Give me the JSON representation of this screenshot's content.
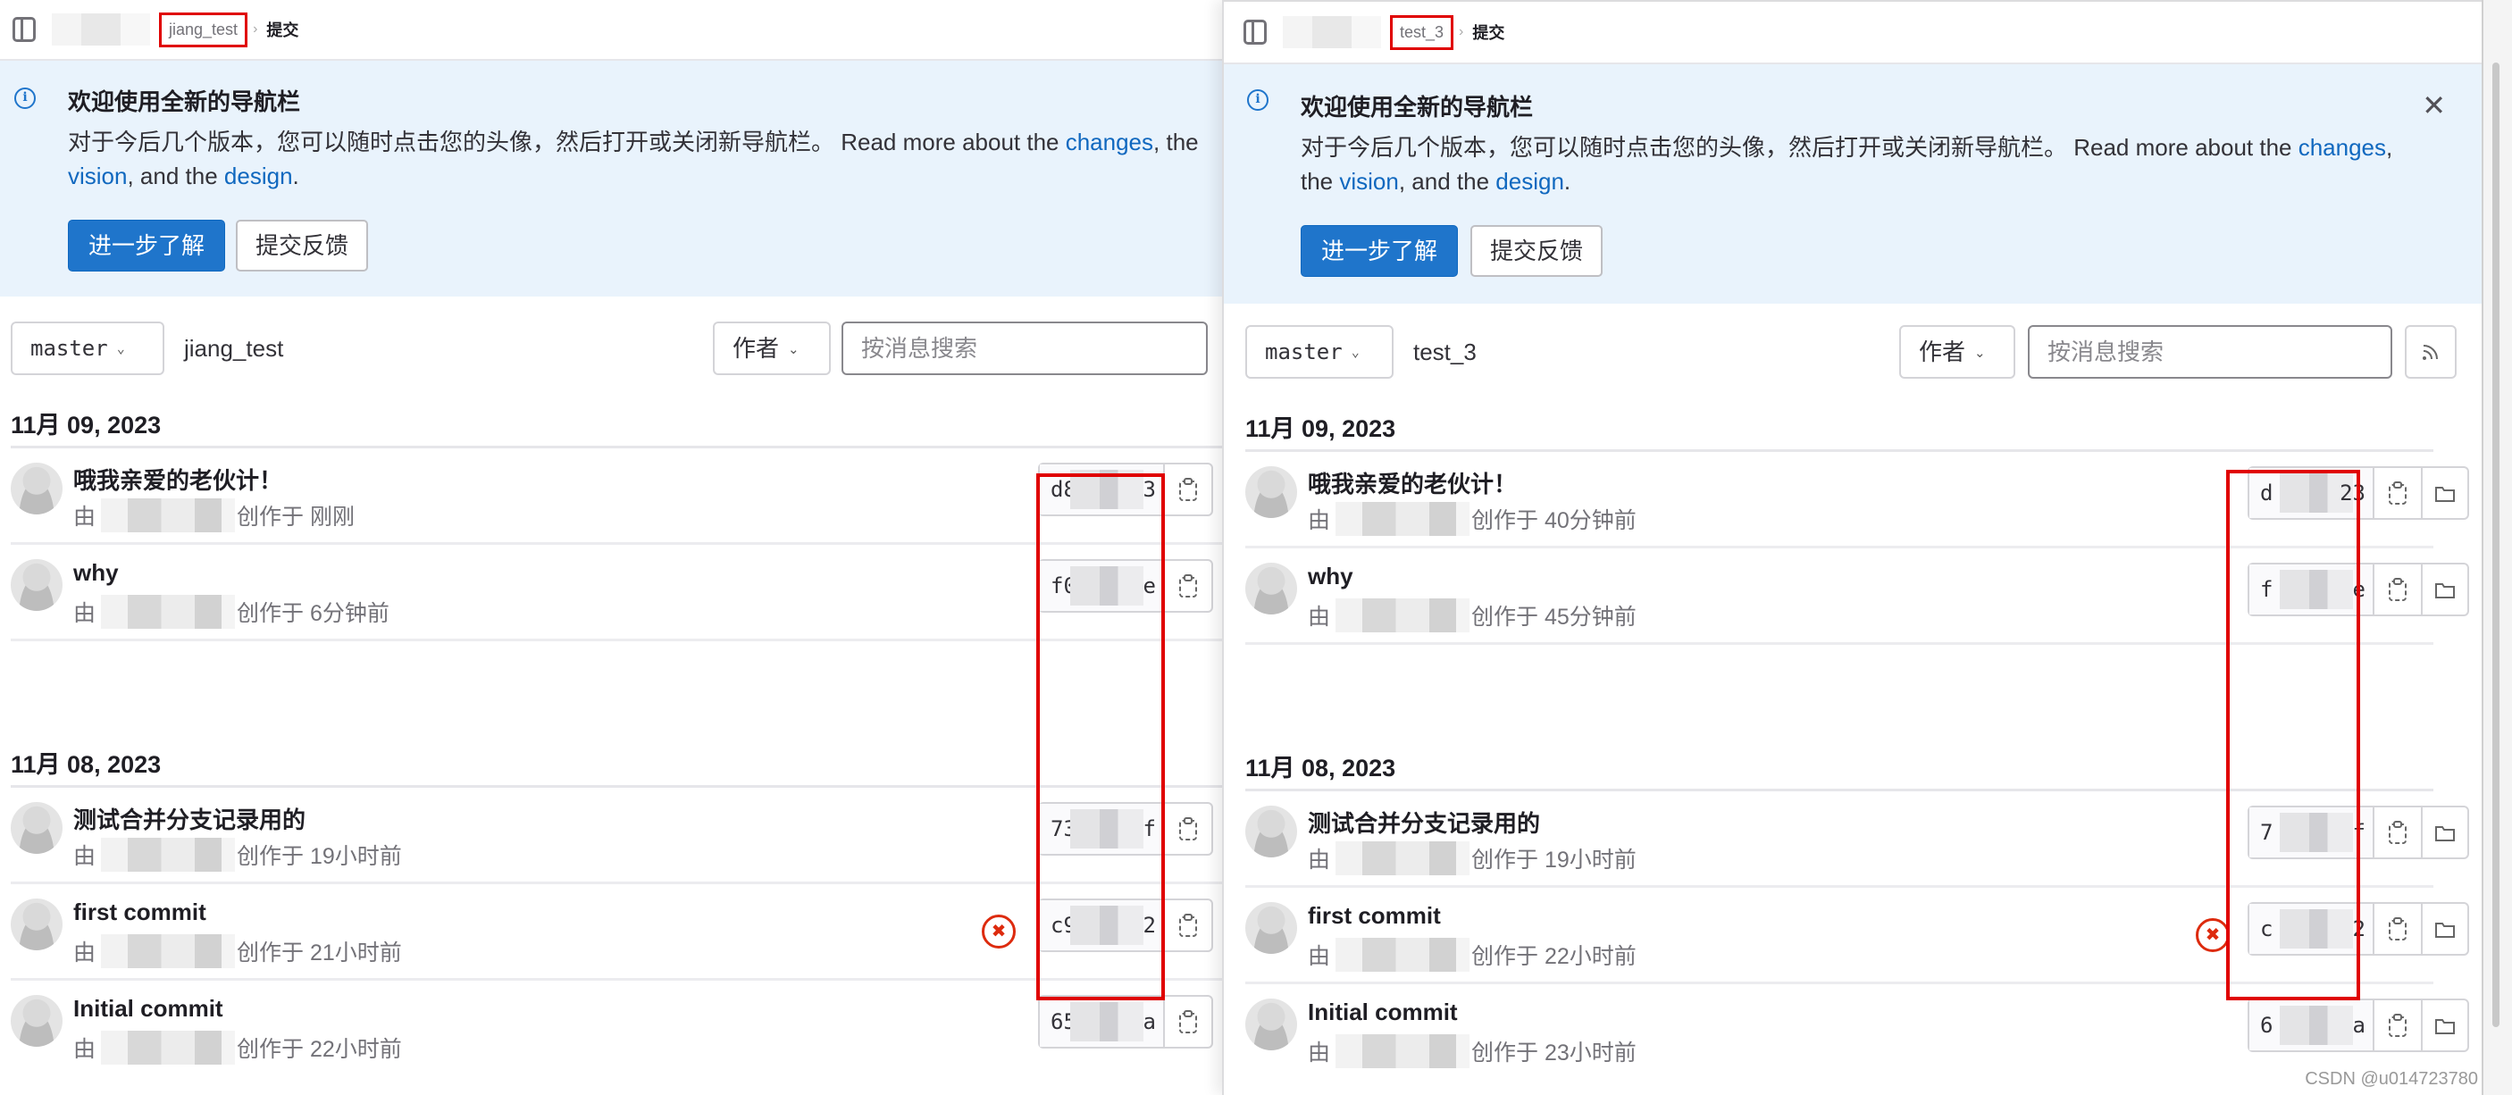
{
  "windows": [
    {
      "id": "left",
      "breadcrumb": {
        "project": "jiang_test",
        "current": "提交"
      },
      "banner": {
        "title": "欢迎使用全新的导航栏",
        "body_prefix": "对于今后几个版本，您可以随时点击您的头像，然后打开或关闭新导航栏。 Read more about the ",
        "link_changes": "changes",
        "sep1": ", the ",
        "link_vision": "vision",
        "sep2": ", and the ",
        "link_design": "design",
        "suffix": ".",
        "primary_button": "进一步了解",
        "secondary_button": "提交反馈",
        "closable": false
      },
      "toolbar": {
        "ref": "master",
        "project": "jiang_test",
        "author_filter": "作者",
        "search_placeholder": "按消息搜索",
        "rss": false
      },
      "groups": [
        {
          "date": "11月 09, 2023",
          "commits": [
            {
              "title": "哦我亲爱的老伙计！",
              "by": "由",
              "created": "创作于 刚刚",
              "sha_start": "d8",
              "sha_end": "3",
              "pipeline_failed": false
            },
            {
              "title": "why",
              "by": "由",
              "created": "创作于 6分钟前",
              "sha_start": "f0",
              "sha_end": "e",
              "pipeline_failed": false
            }
          ]
        },
        {
          "date": "11月 08, 2023",
          "commits": [
            {
              "title": "测试合并分支记录用的",
              "by": "由",
              "created": "创作于 19小时前",
              "sha_start": "73",
              "sha_end": "f",
              "pipeline_failed": false
            },
            {
              "title": "first commit",
              "by": "由",
              "created": "创作于 21小时前",
              "sha_start": "c9",
              "sha_end": "2",
              "pipeline_failed": true
            },
            {
              "title": "Initial commit",
              "by": "由",
              "created": "创作于 22小时前",
              "sha_start": "65",
              "sha_end": "a",
              "pipeline_failed": false
            }
          ]
        }
      ]
    },
    {
      "id": "right",
      "breadcrumb": {
        "project": "test_3",
        "current": "提交"
      },
      "banner": {
        "title": "欢迎使用全新的导航栏",
        "body_prefix": "对于今后几个版本，您可以随时点击您的头像，然后打开或关闭新导航栏。 Read more about the ",
        "link_changes": "changes",
        "sep1": ", the ",
        "link_vision": "vision",
        "sep2": ", and the ",
        "link_design": "design",
        "suffix": ".",
        "primary_button": "进一步了解",
        "secondary_button": "提交反馈",
        "closable": true
      },
      "toolbar": {
        "ref": "master",
        "project": "test_3",
        "author_filter": "作者",
        "search_placeholder": "按消息搜索",
        "rss": true
      },
      "groups": [
        {
          "date": "11月 09, 2023",
          "commits": [
            {
              "title": "哦我亲爱的老伙计！",
              "by": "由",
              "created": "创作于 40分钟前",
              "sha_start": "d",
              "sha_end": "23",
              "pipeline_failed": false
            },
            {
              "title": "why",
              "by": "由",
              "created": "创作于 45分钟前",
              "sha_start": "f",
              "sha_end": "e",
              "pipeline_failed": false
            }
          ]
        },
        {
          "date": "11月 08, 2023",
          "commits": [
            {
              "title": "测试合并分支记录用的",
              "by": "由",
              "created": "创作于 19小时前",
              "sha_start": "7",
              "sha_end": "f",
              "pipeline_failed": false
            },
            {
              "title": "first commit",
              "by": "由",
              "created": "创作于 22小时前",
              "sha_start": "c",
              "sha_end": "2",
              "pipeline_failed": true
            },
            {
              "title": "Initial commit",
              "by": "由",
              "created": "创作于 23小时前",
              "sha_start": "6",
              "sha_end": "a",
              "pipeline_failed": false
            }
          ]
        }
      ]
    }
  ],
  "icons": {
    "info": "i",
    "close": "✕",
    "chevron_down": "⌄",
    "failed": "✖",
    "rss": "◝"
  },
  "watermark": "CSDN @u014723780"
}
